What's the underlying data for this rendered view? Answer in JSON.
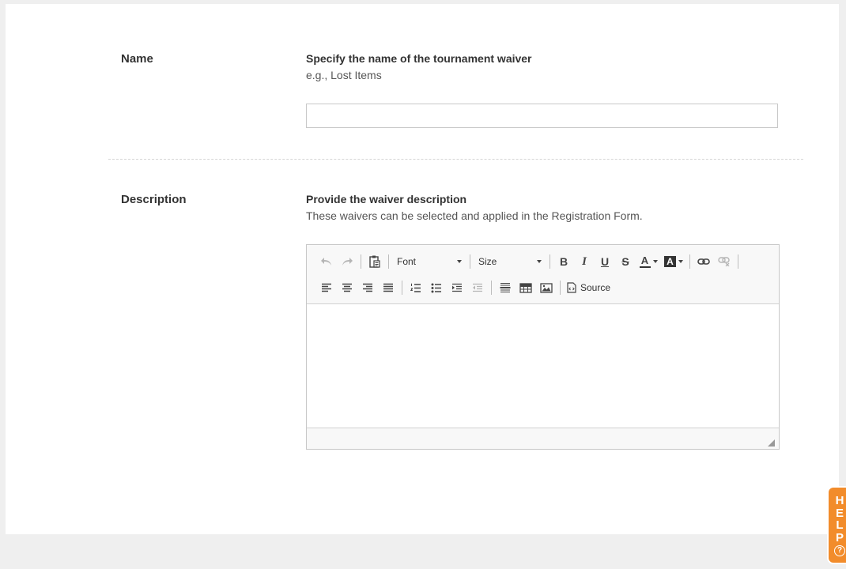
{
  "name_section": {
    "label": "Name",
    "title": "Specify the name of the tournament waiver",
    "help": "e.g., Lost Items",
    "input_value": ""
  },
  "description_section": {
    "label": "Description",
    "title": "Provide the waiver description",
    "help": "These waivers can be selected and applied in the Registration Form.",
    "editor_content": ""
  },
  "editor_toolbar": {
    "font_label": "Font",
    "size_label": "Size",
    "source_label": "Source",
    "bold_glyph": "B",
    "italic_glyph": "I",
    "underline_glyph": "U",
    "strike_glyph": "S",
    "text_color_glyph": "A",
    "bg_color_glyph": "A"
  },
  "help_tab": {
    "letters": [
      "H",
      "E",
      "L",
      "P"
    ],
    "question_glyph": "?"
  },
  "colors": {
    "help_accent": "#f28c2b",
    "page_background": "#efefef",
    "card_background": "#ffffff"
  }
}
